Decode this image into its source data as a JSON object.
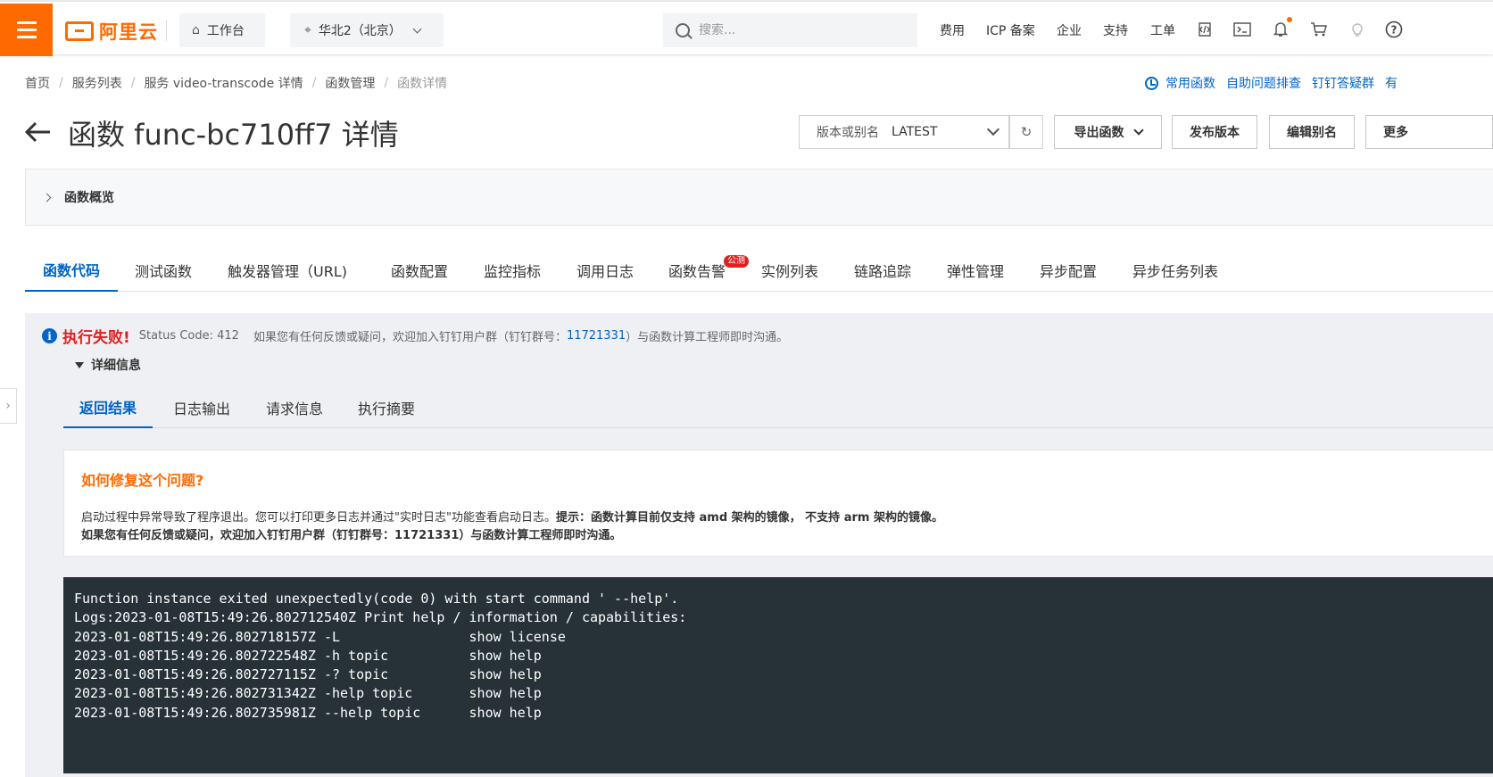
{
  "topbar": {
    "logo_text": "阿里云",
    "workbench": "工作台",
    "region": "华北2（北京）",
    "search_placeholder": "搜索...",
    "nav": [
      "费用",
      "ICP 备案",
      "企业",
      "支持",
      "工单"
    ]
  },
  "breadcrumb": [
    "首页",
    "服务列表",
    "服务 video-transcode 详情",
    "函数管理",
    "函数详情"
  ],
  "quicklinks": [
    "常用函数",
    "自助问题排查",
    "钉钉答疑群",
    "有"
  ],
  "page": {
    "title": "函数 func-bc710ff7 详情",
    "version_label": "版本或别名",
    "version_value": "LATEST",
    "buttons": [
      "导出函数",
      "发布版本",
      "编辑别名",
      "更多"
    ]
  },
  "overview_label": "函数概览",
  "tabs": [
    "函数代码",
    "测试函数",
    "触发器管理（URL)",
    "函数配置",
    "监控指标",
    "调用日志",
    "函数告警",
    "实例列表",
    "链路追踪",
    "弹性管理",
    "异步配置",
    "异步任务列表"
  ],
  "beta_badge": "公测",
  "result": {
    "fail_text": "执行失败!",
    "status_code": "Status Code: 412",
    "feedback_prefix": "如果您有任何反馈或疑问，欢迎加入钉钉用户群（钉钉群号：",
    "group_id": "11721331",
    "feedback_suffix": "）与函数计算工程师即时沟通。",
    "details_label": "详细信息",
    "subtabs": [
      "返回结果",
      "日志输出",
      "请求信息",
      "执行摘要"
    ]
  },
  "fix": {
    "title": "如何修复这个问题?",
    "line1_normal": "启动过程中异常导致了程序退出。您可以打印更多日志并通过\"实时日志\"功能查看启动日志。",
    "line1_bold": "提示：函数计算目前仅支持 amd 架构的镜像， 不支持 arm 架构的镜像。",
    "line2": "如果您有任何反馈或疑问，欢迎加入钉钉用户群（钉钉群号：11721331）与函数计算工程师即时沟通。"
  },
  "console_lines": [
    "Function instance exited unexpectedly(code 0) with start command ' --help'.",
    "Logs:2023-01-08T15:49:26.802712540Z Print help / information / capabilities:",
    "2023-01-08T15:49:26.802718157Z -L                show license",
    "2023-01-08T15:49:26.802722548Z -h topic          show help",
    "2023-01-08T15:49:26.802727115Z -? topic          show help",
    "2023-01-08T15:49:26.802731342Z -help topic       show help",
    "2023-01-08T15:49:26.802735981Z --help topic      show help"
  ],
  "colors": {
    "brand": "#ff6a00",
    "link": "#0064c8",
    "error": "#e02020",
    "console_bg": "#263238"
  },
  "icons": [
    "menu-icon",
    "home-icon",
    "location-icon",
    "search-icon",
    "ide-icon",
    "terminal-icon",
    "bell-icon",
    "cart-icon",
    "lightbulb-icon",
    "help-icon",
    "clock-icon",
    "back-arrow-icon",
    "refresh-icon",
    "info-icon"
  ]
}
